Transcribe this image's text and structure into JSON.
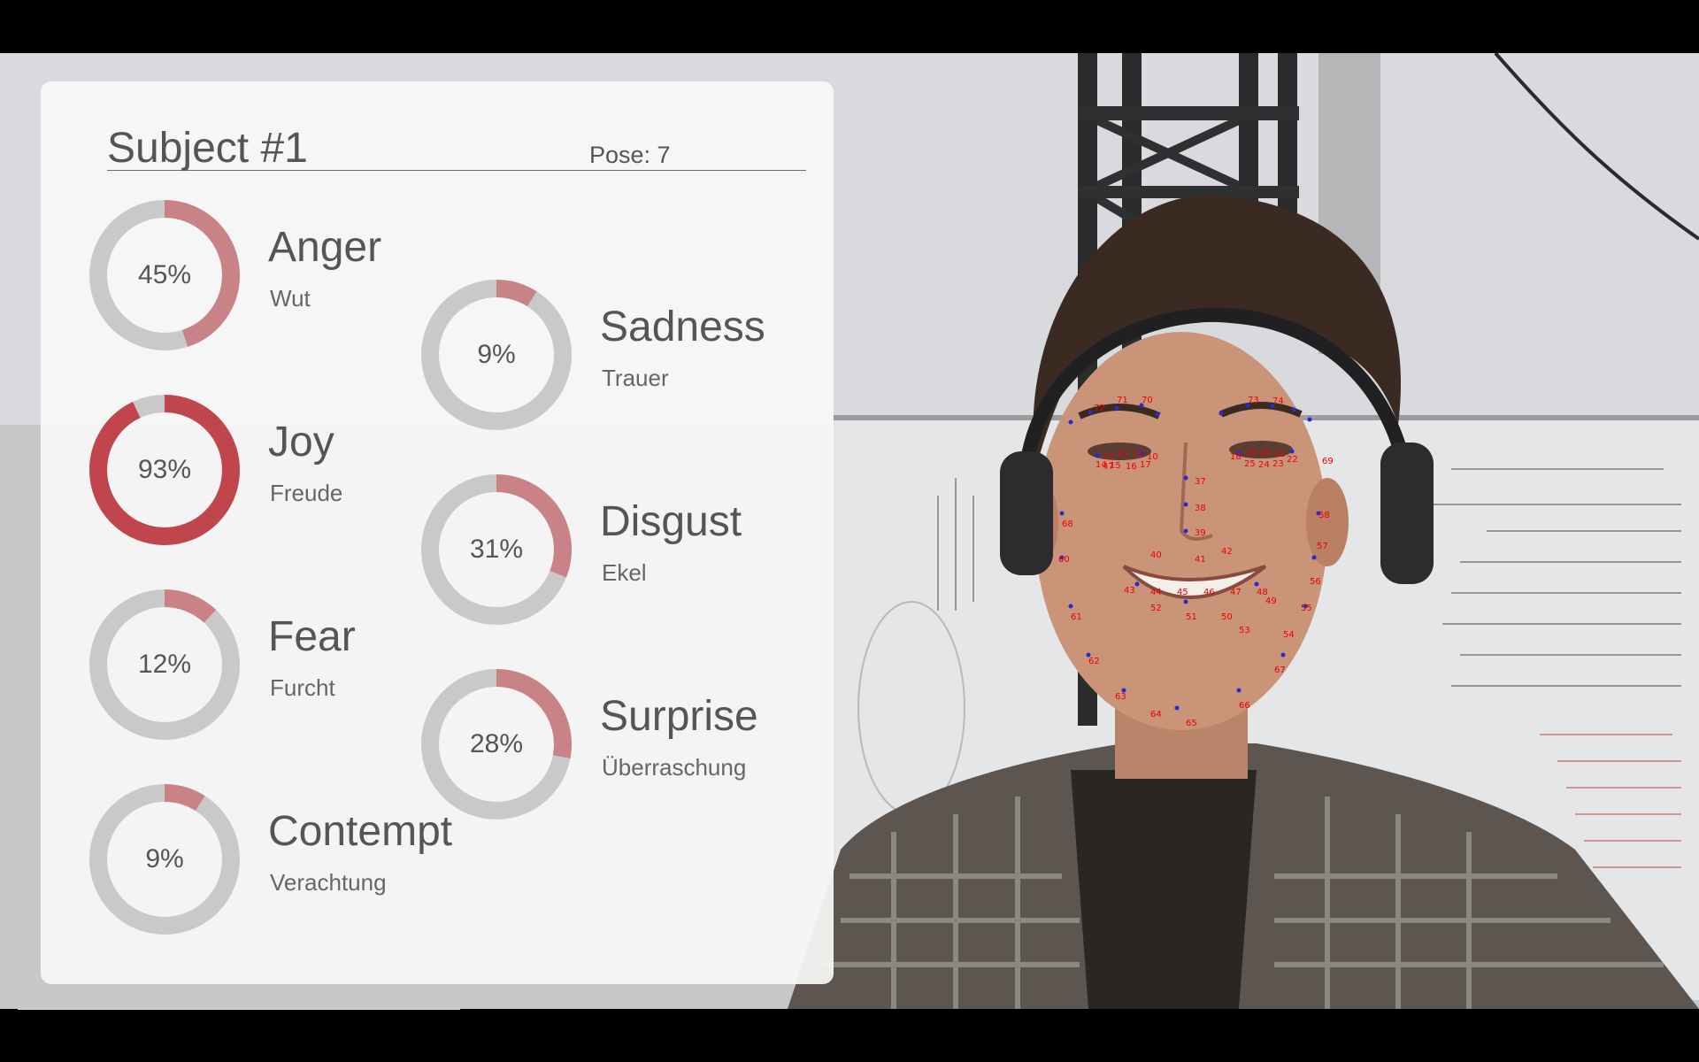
{
  "panel": {
    "subject_title": "Subject #1",
    "pose_label": "Pose: 7"
  },
  "emotions": [
    {
      "name": "Anger",
      "sub": "Wut",
      "percent_label": "45%",
      "value": 45
    },
    {
      "name": "Joy",
      "sub": "Freude",
      "percent_label": "93%",
      "value": 93
    },
    {
      "name": "Fear",
      "sub": "Furcht",
      "percent_label": "12%",
      "value": 12
    },
    {
      "name": "Contempt",
      "sub": "Verachtung",
      "percent_label": "9%",
      "value": 9
    },
    {
      "name": "Sadness",
      "sub": "Trauer",
      "percent_label": "9%",
      "value": 9
    },
    {
      "name": "Disgust",
      "sub": "Ekel",
      "percent_label": "31%",
      "value": 31
    },
    {
      "name": "Surprise",
      "sub": "Überraschung",
      "percent_label": "28%",
      "value": 28
    }
  ],
  "colors": {
    "ring_track": "#c9c9c9",
    "ring_low": "#c98285",
    "ring_high": "#c0454c",
    "text": "#555555",
    "landmark": "#e00000",
    "landmark_dot": "#2a2ad0"
  },
  "camera": {
    "landmark_labels": [
      "71",
      "70",
      "72",
      "73",
      "74",
      "12",
      "11",
      "13",
      "10",
      "14",
      "15",
      "16",
      "17",
      "19",
      "20",
      "21",
      "18",
      "25",
      "24",
      "23",
      "22",
      "69",
      "47",
      "46",
      "48",
      "45",
      "44",
      "43",
      "42",
      "41",
      "40",
      "39",
      "38",
      "37",
      "36",
      "35",
      "34",
      "33",
      "32",
      "31",
      "30",
      "29",
      "28",
      "27",
      "26",
      "51",
      "50",
      "49",
      "52",
      "53",
      "54",
      "55",
      "56",
      "57",
      "58",
      "59",
      "60",
      "61",
      "62",
      "63",
      "64",
      "65",
      "66",
      "67",
      "68"
    ]
  }
}
